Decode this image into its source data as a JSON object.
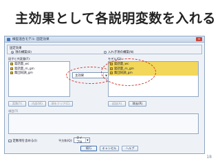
{
  "slide": {
    "title": "主効果として各説明変数を入れる",
    "page_number": "18"
  },
  "dialog": {
    "title": "線型混合モデル: 固定効果",
    "fixed_effects_group": "固定効果",
    "radio_build_terms": "項の構築(B)",
    "radio_nested_terms": "入れ子項の構築(N)",
    "factors_covariates_label": "因子と共変量(F):",
    "model_label": "モデル(O):",
    "factors_covariates": [
      "発話量_wc",
      "発話量_m_gm",
      "集団同調_gm"
    ],
    "model_terms": [
      "発話量_wc",
      "発話量_m_gm",
      "集団同調_gm"
    ],
    "term_type": "主効果",
    "buttons_mid": {
      "by": "実数(Y)",
      "within": "内部(W)",
      "clear_term": "項をクリア(C)",
      "add": "追加(A)",
      "remove": "除去(R)"
    },
    "term_label": "項目(T)",
    "include_intercept": "定数項を含める(I)",
    "sum_of_squares_label": "平方和(Q):",
    "sum_of_squares_value": "タイプIII",
    "footer": {
      "continue": "続行",
      "cancel": "キャンセル",
      "help": "ヘルプ"
    }
  }
}
